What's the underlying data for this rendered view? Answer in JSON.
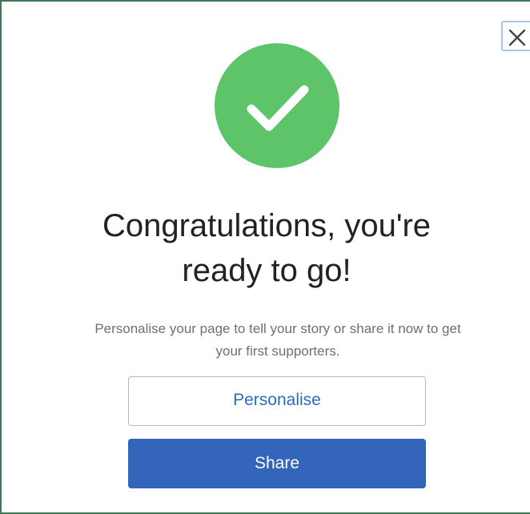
{
  "dialog": {
    "close_icon": "close-icon",
    "success_icon": "checkmark-icon",
    "success_color": "#5ec46a",
    "title_line1": "Congratulations, you're",
    "title_line2": "ready to go!",
    "message_line1": "Personalise your page to tell your story or share it now to get",
    "message_line2": "your first supporters.",
    "personalise_label": "Personalise",
    "share_label": "Share",
    "accent_color": "#3366bb"
  }
}
